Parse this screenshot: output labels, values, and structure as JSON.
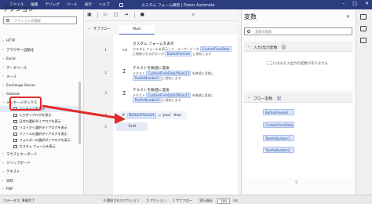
{
  "titlebar": {
    "menu": [
      "ファイル",
      "編集",
      "デバッグ",
      "ツール",
      "表示",
      "ヘルプ"
    ],
    "title": "カスタム フォーム練習 | Power Automate"
  },
  "actions_panel": {
    "title": "アクション",
    "search_placeholder": "アクションの検索",
    "categories": [
      "HTTP",
      "ブラウザー自動化",
      "Excel",
      "データベース",
      "メール",
      "Exchange Server",
      "Outlook"
    ],
    "message_box": {
      "label": "メッセージボックス",
      "items": [
        "メッセージを表示",
        "入力ダイアログを表示",
        "日付の選択ダイアログを表示",
        "リストから選択ダイアログを表示",
        "ファイルの選択ダイアログを表示",
        "フォルダーの選択ダイアログを表示",
        "カスタム フォームを表示"
      ]
    },
    "categories_after": [
      "マウスとキーボード",
      "クリップボード",
      "テキスト",
      "日時",
      "PDF"
    ]
  },
  "designer": {
    "subflow_label": "サブフロー",
    "main_tab": "Main",
    "steps": [
      {
        "line": "1",
        "title": "カスタム フォームを表示",
        "desc1": "カスタム フォームを表示して、ユーザーデータ",
        "tag_a": "CustomFormData",
        "desc2": "に格納されるボタンが",
        "tag_b": "ButtonPressed",
        "desc3": "に保存します"
      },
      {
        "line": "2",
        "title": "テキストを数値に変換",
        "desc_prefix": "テキスト",
        "tag_a": "CustomFormData['Num1']",
        "desc_mid": "を数値に変換し",
        "tag_b": "TextAsNumber1",
        "desc_suffix": "に保存します"
      },
      {
        "line": "3",
        "title": "テキストを数値に変換",
        "desc_prefix": "テキスト",
        "tag_a": "CustomFormData['Num2']",
        "desc_mid": "を数値に変換し",
        "tag_b": "TextAsNumber2",
        "desc_suffix": "に保存します"
      }
    ],
    "if_row": {
      "line": "4",
      "keyword": "If",
      "var": "ButtonPressed",
      "op": "= 'plus'",
      "then": "then"
    },
    "end_row": {
      "line": "5",
      "label": "End"
    }
  },
  "variables_panel": {
    "title": "変数",
    "search_placeholder": "変数の検索",
    "input_output": {
      "label": "入力/出力変数",
      "count": "0",
      "empty_message": "ここにはまだ入出力の変数がありません"
    },
    "flow_vars": {
      "label": "フロー変数",
      "count": "4",
      "items": [
        "ButtonPressed",
        "CustomFormData",
        "TextAsNumber1",
        "TextAsNumber2"
      ]
    }
  },
  "statusbar": {
    "status": "ステータス: 準備完了",
    "selected": "0 選択されたアクション",
    "actions": "5 アクション",
    "subflows": "1 サブフロー",
    "delay_label": "実行遅延",
    "delay_value": "100",
    "delay_unit": "ms"
  },
  "colors": {
    "titlebar": "#2b3d7e",
    "highlight": "#e22b2b",
    "tag_bg": "#dbe6fb"
  }
}
